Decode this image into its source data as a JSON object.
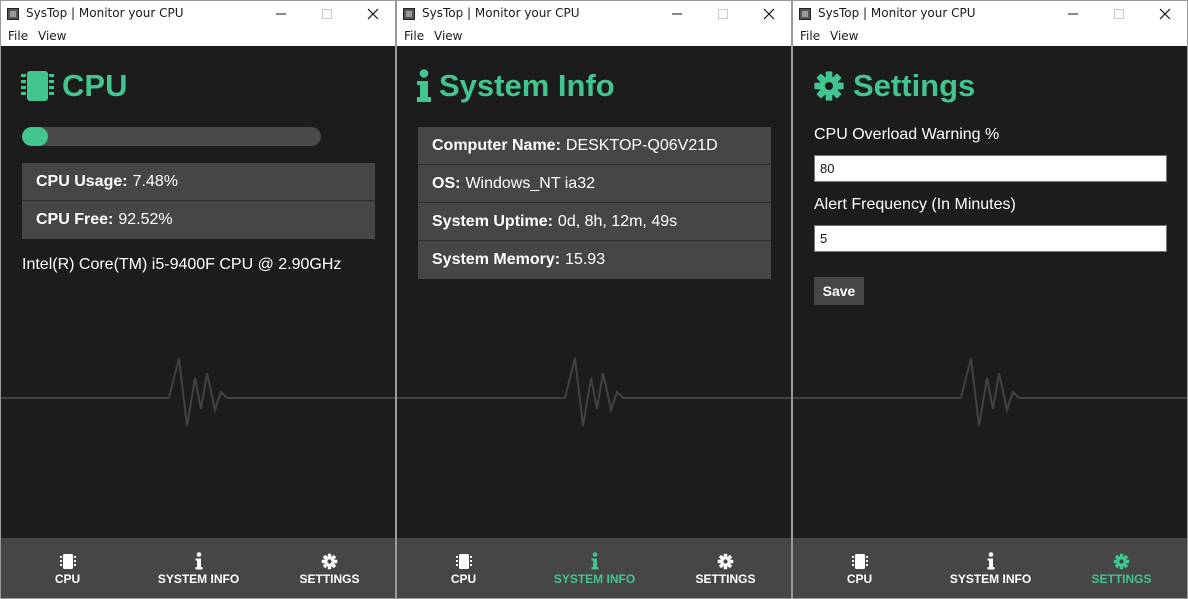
{
  "app": {
    "title": "SysTop | Monitor your CPU",
    "menu": [
      "File",
      "View"
    ]
  },
  "colors": {
    "accent": "#43c590",
    "background": "#1c1c1c",
    "panel": "#464646",
    "text": "#ffffff"
  },
  "nav": {
    "cpu": "CPU",
    "system_info": "SYSTEM INFO",
    "settings": "SETTINGS"
  },
  "windows": [
    {
      "active_tab": "cpu",
      "heading": "CPU",
      "heading_icon": "microchip-icon",
      "cpu_usage_progress_percent": 7.48,
      "rows": [
        {
          "label": "CPU Usage:",
          "value": "7.48%"
        },
        {
          "label": "CPU Free:",
          "value": "92.52%"
        }
      ],
      "cpu_model": "Intel(R) Core(TM) i5-9400F CPU @ 2.90GHz"
    },
    {
      "active_tab": "system_info",
      "heading": "System Info",
      "heading_icon": "info-icon",
      "rows": [
        {
          "label": "Computer Name:",
          "value": "DESKTOP-Q06V21D"
        },
        {
          "label": "OS:",
          "value": "Windows_NT ia32"
        },
        {
          "label": "System Uptime:",
          "value": "0d, 8h, 12m, 49s"
        },
        {
          "label": "System Memory:",
          "value": "15.93"
        }
      ]
    },
    {
      "active_tab": "settings",
      "heading": "Settings",
      "heading_icon": "gear-icon",
      "cpu_overload_label": "CPU Overload Warning %",
      "cpu_overload_value": "80",
      "alert_frequency_label": "Alert Frequency (In Minutes)",
      "alert_frequency_value": "5",
      "save_label": "Save"
    }
  ]
}
